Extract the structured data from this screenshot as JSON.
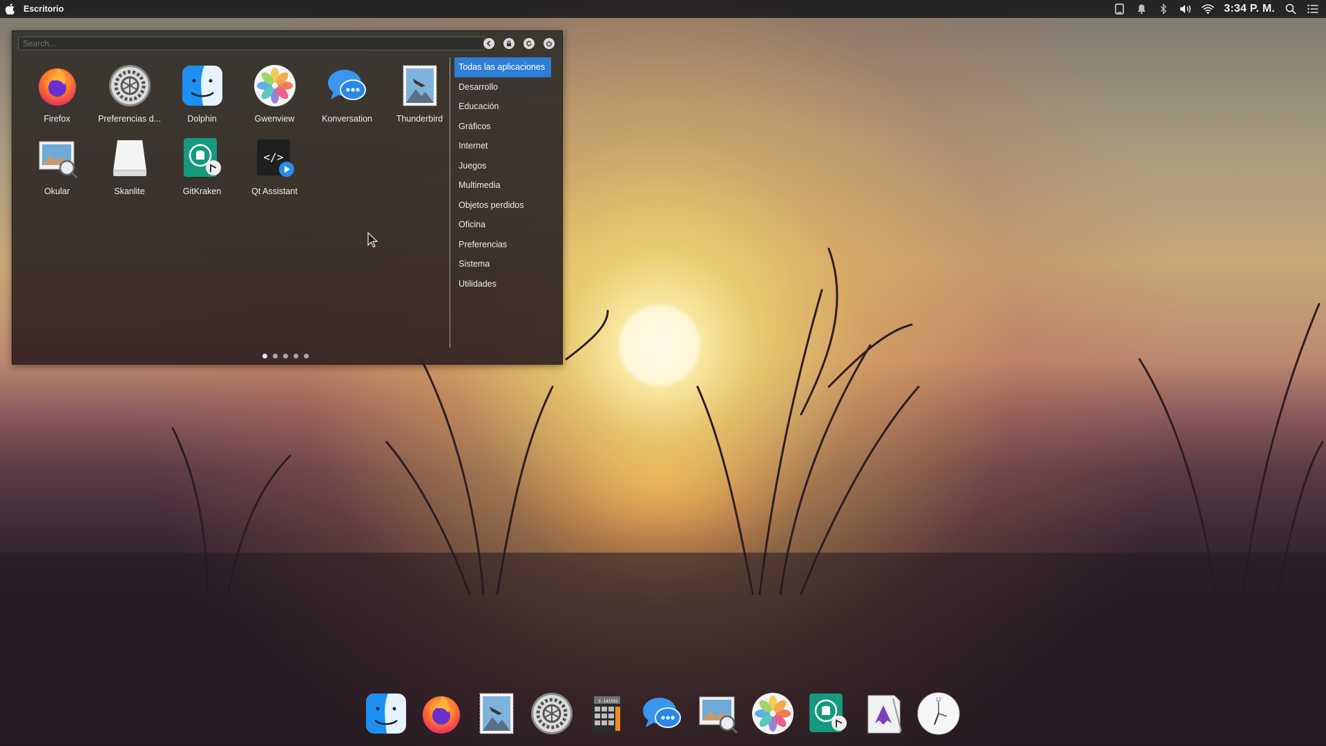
{
  "menubar": {
    "app_title": "Escritorio",
    "clock": "3:34 P. M.",
    "status_icons": [
      "tablet-icon",
      "bell-icon",
      "bluetooth-icon",
      "volume-icon",
      "wifi-icon"
    ],
    "right_icons": [
      "search-icon",
      "list-icon"
    ]
  },
  "launcher": {
    "search_placeholder": "Search...",
    "controls": [
      "back-icon",
      "lock-icon",
      "refresh-icon",
      "power-icon"
    ],
    "apps": [
      {
        "label": "Firefox",
        "icon": "firefox-icon"
      },
      {
        "label": "Preferencias d...",
        "icon": "gear-icon"
      },
      {
        "label": "Dolphin",
        "icon": "finder-icon"
      },
      {
        "label": "Gwenview",
        "icon": "photos-icon"
      },
      {
        "label": "Konversation",
        "icon": "chat-bubble-icon"
      },
      {
        "label": "Thunderbird",
        "icon": "mail-stamp-icon"
      },
      {
        "label": "Okular",
        "icon": "preview-icon"
      },
      {
        "label": "Skanlite",
        "icon": "scanner-icon"
      },
      {
        "label": "GitKraken",
        "icon": "gitkraken-icon"
      },
      {
        "label": "Qt Assistant",
        "icon": "code-assistant-icon"
      }
    ],
    "categories": [
      "Todas las aplicaciones",
      "Desarrollo",
      "Educación",
      "Gráficos",
      "Internet",
      "Juegos",
      "Multimedia",
      "Objetos perdidos",
      "Oficina",
      "Preferencias",
      "Sistema",
      "Utilidades"
    ],
    "active_category": "Todas las aplicaciones",
    "pages": 5,
    "current_page": 1
  },
  "dock": {
    "items": [
      "finder-icon",
      "firefox-icon",
      "mail-stamp-icon",
      "gear-icon",
      "calculator-icon",
      "chat-bubble-icon",
      "preview-icon",
      "photos-icon",
      "gitkraken-icon",
      "inkscape-icon",
      "clock-icon"
    ],
    "calculator_display": "3.141592"
  },
  "colors": {
    "accent": "#2e7ed6",
    "menubar": "#1e1e1e"
  }
}
